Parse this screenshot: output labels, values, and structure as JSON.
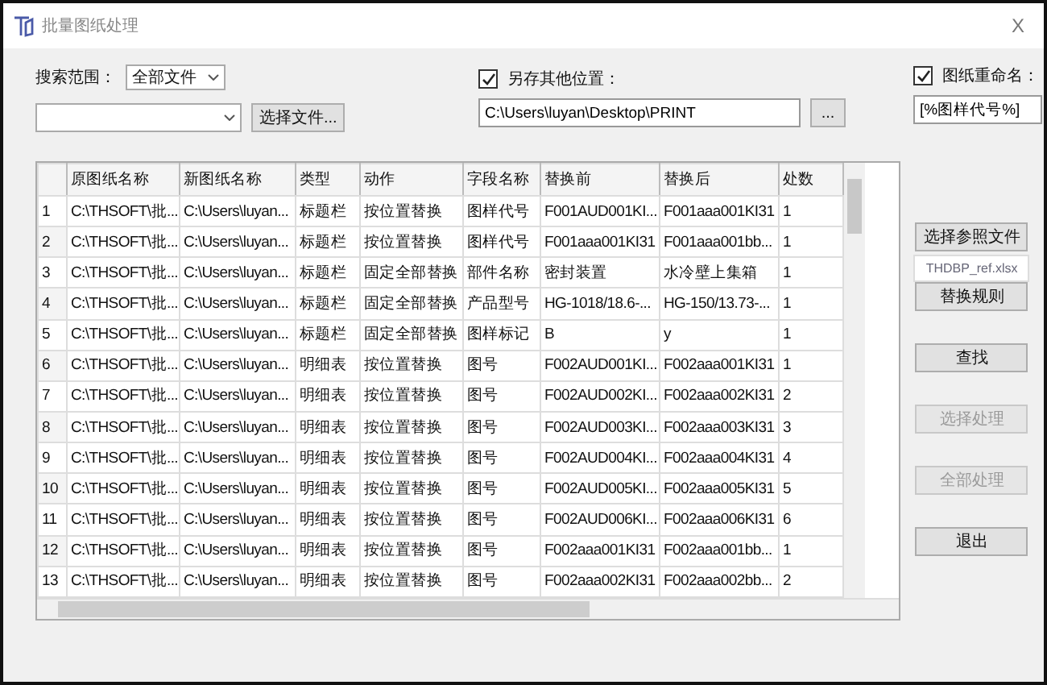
{
  "window": {
    "title": "批量图纸处理",
    "close": "X"
  },
  "search_scope": {
    "label": "搜索范围：",
    "value": "全部文件"
  },
  "file_select": {
    "button": "选择文件..."
  },
  "save_elsewhere": {
    "label": "另存其他位置：",
    "checked": true,
    "path": "C:\\Users\\luyan\\Desktop\\PRINT",
    "browse": "..."
  },
  "rename": {
    "label": "图纸重命名：",
    "checked": true,
    "pattern": "[%图样代号%]"
  },
  "table": {
    "columns": [
      "原图纸名称",
      "新图纸名称",
      "类型",
      "动作",
      "字段名称",
      "替换前",
      "替换后",
      "处数"
    ],
    "rows": [
      {
        "number": "1",
        "cells": [
          "C:\\THSOFT\\批...",
          "C:\\Users\\luyan...",
          "标题栏",
          "按位置替换",
          "图样代号",
          "F001AUD001KI...",
          "F001aaa001KI31",
          "1"
        ]
      },
      {
        "number": "2",
        "cells": [
          "C:\\THSOFT\\批...",
          "C:\\Users\\luyan...",
          "标题栏",
          "按位置替换",
          "图样代号",
          "F001aaa001KI31",
          "F001aaa001bb...",
          "1"
        ]
      },
      {
        "number": "3",
        "cells": [
          "C:\\THSOFT\\批...",
          "C:\\Users\\luyan...",
          "标题栏",
          "固定全部替换",
          "部件名称",
          "密封装置",
          "水冷壁上集箱",
          "1"
        ]
      },
      {
        "number": "4",
        "cells": [
          "C:\\THSOFT\\批...",
          "C:\\Users\\luyan...",
          "标题栏",
          "固定全部替换",
          "产品型号",
          "HG-1018/18.6-...",
          "HG-150/13.73-...",
          "1"
        ]
      },
      {
        "number": "5",
        "cells": [
          "C:\\THSOFT\\批...",
          "C:\\Users\\luyan...",
          "标题栏",
          "固定全部替换",
          "图样标记",
          "B",
          "y",
          "1"
        ]
      },
      {
        "number": "6",
        "cells": [
          "C:\\THSOFT\\批...",
          "C:\\Users\\luyan...",
          "明细表",
          "按位置替换",
          "图号",
          "F002AUD001KI...",
          "F002aaa001KI31",
          "1"
        ]
      },
      {
        "number": "7",
        "cells": [
          "C:\\THSOFT\\批...",
          "C:\\Users\\luyan...",
          "明细表",
          "按位置替换",
          "图号",
          "F002AUD002KI...",
          "F002aaa002KI31",
          "2"
        ]
      },
      {
        "number": "8",
        "cells": [
          "C:\\THSOFT\\批...",
          "C:\\Users\\luyan...",
          "明细表",
          "按位置替换",
          "图号",
          "F002AUD003KI...",
          "F002aaa003KI31",
          "3"
        ]
      },
      {
        "number": "9",
        "cells": [
          "C:\\THSOFT\\批...",
          "C:\\Users\\luyan...",
          "明细表",
          "按位置替换",
          "图号",
          "F002AUD004KI...",
          "F002aaa004KI31",
          "4"
        ]
      },
      {
        "number": "10",
        "cells": [
          "C:\\THSOFT\\批...",
          "C:\\Users\\luyan...",
          "明细表",
          "按位置替换",
          "图号",
          "F002AUD005KI...",
          "F002aaa005KI31",
          "5"
        ]
      },
      {
        "number": "11",
        "cells": [
          "C:\\THSOFT\\批...",
          "C:\\Users\\luyan...",
          "明细表",
          "按位置替换",
          "图号",
          "F002AUD006KI...",
          "F002aaa006KI31",
          "6"
        ]
      },
      {
        "number": "12",
        "cells": [
          "C:\\THSOFT\\批...",
          "C:\\Users\\luyan...",
          "明细表",
          "按位置替换",
          "图号",
          "F002aaa001KI31",
          "F002aaa001bb...",
          "1"
        ]
      },
      {
        "number": "13",
        "cells": [
          "C:\\THSOFT\\批...",
          "C:\\Users\\luyan...",
          "明细表",
          "按位置替换",
          "图号",
          "F002aaa002KI31",
          "F002aaa002bb...",
          "2"
        ]
      }
    ]
  },
  "side": {
    "ref_button": "选择参照文件",
    "ref_file": "THDBP_ref.xlsx",
    "buttons": [
      {
        "label": "替换规则",
        "disabled": false
      },
      {
        "label": "查找",
        "disabled": false
      },
      {
        "label": "选择处理",
        "disabled": true
      },
      {
        "label": "全部处理",
        "disabled": true
      },
      {
        "label": "退出",
        "disabled": false
      }
    ]
  }
}
